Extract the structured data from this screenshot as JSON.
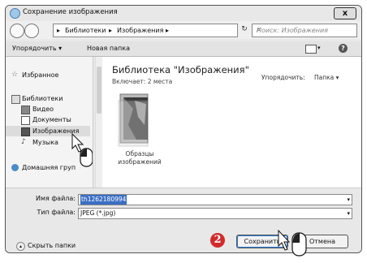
{
  "window": {
    "title": "Сохранение изображения",
    "close_label": "x"
  },
  "navbar": {
    "breadcrumb": [
      "Библиотеки",
      "Изображения"
    ],
    "separator": "▸",
    "refresh_glyph": "↻",
    "search_placeholder": "Поиск: Изображения",
    "search_glyph": "⌕"
  },
  "toolbar": {
    "organize_label": "Упорядочить ▾",
    "new_folder_label": "Новая папка",
    "help_glyph": "?"
  },
  "sidebar": {
    "items": [
      {
        "label": "Избранное",
        "icon": "star-icon"
      },
      {
        "label": "Библиотеки",
        "icon": "library-icon"
      },
      {
        "label": "Видео",
        "icon": "video-icon"
      },
      {
        "label": "Документы",
        "icon": "documents-icon"
      },
      {
        "label": "Изображения",
        "icon": "pictures-icon"
      },
      {
        "label": "Музыка",
        "icon": "music-icon"
      },
      {
        "label": "Домашняя груп",
        "icon": "homegroup-icon"
      }
    ],
    "selected": "Изображения"
  },
  "content": {
    "library_title": "Библиотека \"Изображения\"",
    "library_subtitle": "Включает: 2 места",
    "arrange_label": "Упорядочить:",
    "arrange_value": "Папка ▾",
    "folder_label_line1": "Образцы",
    "folder_label_line2": "изображений"
  },
  "footer": {
    "filename_label": "Имя файла:",
    "filename_value": "th1262180994",
    "filetype_label": "Тип файла:",
    "filetype_value": "JPEG (*.jpg)",
    "hide_folders_label": "Скрыть папки",
    "save_label": "Сохранить",
    "cancel_label": "Отмена",
    "step_badge": "2"
  },
  "colors": {
    "accent": "#2a7ad6",
    "badge": "#d22a2a"
  }
}
